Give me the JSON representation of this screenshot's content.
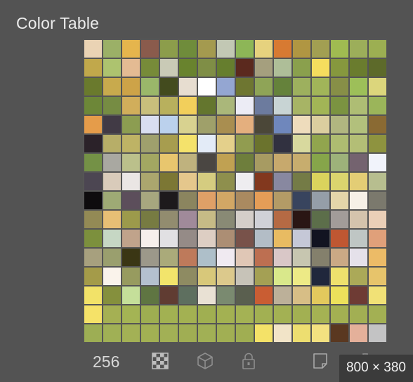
{
  "panel": {
    "title": "Color Table"
  },
  "color_table": {
    "rows": [
      [
        "#EAD3B4",
        "#9BB067",
        "#E5B54D",
        "#8A5B4C",
        "#8C9D4B",
        "#6F8C3B",
        "#A49A4F",
        "#C2C8B4",
        "#8DB657",
        "#E6D27E",
        "#D77A32",
        "#B09642",
        "#A29F52",
        "#A0BB51",
        "#9CAE5A",
        "#9CAF52"
      ],
      [
        "#C1A84B",
        "#ADC36F",
        "#E4BB93",
        "#778B39",
        "#C9CAB6",
        "#69832E",
        "#7F8E46",
        "#667E2E",
        "#5B291E",
        "#A59F7E",
        "#AEBE98",
        "#8AA04D",
        "#F5DD5E",
        "#86983E",
        "#6A7C2E",
        "#5D6A2A"
      ],
      [
        "#6A7A2D",
        "#C8AA4D",
        "#CDA348",
        "#9AB76A",
        "#434B1E",
        "#E7DDD0",
        "#FFFFFF",
        "#94A6D2",
        "#6E7631",
        "#8FA457",
        "#65823B",
        "#9DB05E",
        "#A1B559",
        "#878F47",
        "#9DBF59",
        "#DCD67C"
      ],
      [
        "#6D8738",
        "#768C43",
        "#D1AE5B",
        "#C8BF7C",
        "#B8B05D",
        "#F2CF5B",
        "#64762E",
        "#AAB77A",
        "#ECECF5",
        "#6C7B9E",
        "#C8D4D4",
        "#A7B465",
        "#A2B556",
        "#7B9341",
        "#AEBD74",
        "#9BB55A"
      ],
      [
        "#E59C4A",
        "#413A45",
        "#8C9D51",
        "#D9DEF1",
        "#BBD1ED",
        "#D8D290",
        "#9FA06A",
        "#A98E50",
        "#E4AF7E",
        "#4B4738",
        "#6F87BC",
        "#EEDCBC",
        "#DBCE9F",
        "#B1B680",
        "#B2C07C",
        "#8A6A33"
      ],
      [
        "#2B2229",
        "#B7AE68",
        "#BEB365",
        "#9FA06D",
        "#A79D4F",
        "#F4E26B",
        "#E3EBF7",
        "#E4D08B",
        "#919C50",
        "#6B732D",
        "#313140",
        "#D8D99E",
        "#91A54E",
        "#AEBC71",
        "#B3BE76",
        "#8E933F"
      ],
      [
        "#749146",
        "#A9A8A1",
        "#BBC08B",
        "#A3A762",
        "#E8C66E",
        "#BFB27E",
        "#4A4642",
        "#C0A152",
        "#6E7E3C",
        "#A79B62",
        "#C7A96D",
        "#C7AD6E",
        "#86A54A",
        "#9DB27A",
        "#74636F",
        "#F1F3FB"
      ],
      [
        "#4C4652",
        "#D9CBBA",
        "#EAE6E4",
        "#ABA66E",
        "#7C7734",
        "#E5C78C",
        "#D5CC80",
        "#8E8F4D",
        "#EEEDF0",
        "#82381E",
        "#8888A0",
        "#747B46",
        "#DAD35D",
        "#DBD46E",
        "#E3CD75",
        "#B7BE8F"
      ],
      [
        "#0E0C0E",
        "#9EAA75",
        "#5C4E5B",
        "#A7A77F",
        "#1D1A1C",
        "#8B855F",
        "#DFA067",
        "#D2A765",
        "#AA8A60",
        "#E59D57",
        "#B39B66",
        "#38445E",
        "#959EA8",
        "#E4D6A9",
        "#F6F0E7",
        "#7B796D"
      ],
      [
        "#938A55",
        "#E7BF75",
        "#9C9A4B",
        "#777B42",
        "#928C6F",
        "#A08A9A",
        "#C6BB86",
        "#898A75",
        "#D4CEC9",
        "#D0D1D7",
        "#B56A44",
        "#2A1614",
        "#5C6E4A",
        "#A29C99",
        "#D4C3AC",
        "#EBCFB7"
      ],
      [
        "#7C903D",
        "#C6D7C4",
        "#C0A38B",
        "#F6EFEC",
        "#E1E0E3",
        "#958B87",
        "#DDCEC3",
        "#AC8E74",
        "#78524A",
        "#B3BDC6",
        "#E8BB62",
        "#C5C8D7",
        "#121421",
        "#BF5732",
        "#BFC6C4",
        "#E0A07A"
      ],
      [
        "#A7A07E",
        "#9A9F6E",
        "#3A3614",
        "#9C988A",
        "#AAAA7A",
        "#BE7A5B",
        "#AEBFC9",
        "#F0EAF1",
        "#E0C7B6",
        "#BD6F51",
        "#D9C7C7",
        "#C7C6B0",
        "#84806C",
        "#CAA985",
        "#E5E1EA",
        "#ECBB67"
      ],
      [
        "#A49B49",
        "#FAF3EB",
        "#979B5F",
        "#B4C0CF",
        "#F2E46B",
        "#8E8B62",
        "#D8C87A",
        "#DCC98C",
        "#C7C3B8",
        "#A4A054",
        "#D9E88B",
        "#EDEA86",
        "#20273C",
        "#EEE16D",
        "#ABA958",
        "#E7C46B"
      ],
      [
        "#F2E268",
        "#85903D",
        "#C5DF9A",
        "#5F7542",
        "#603C32",
        "#5E6F5F",
        "#E9E1D4",
        "#7A8A70",
        "#5A5F4F",
        "#C95D33",
        "#BCB099",
        "#D7BE86",
        "#E3C95D",
        "#ECE15B",
        "#6E3B34",
        "#F1E176"
      ],
      [
        "#F5E268",
        "#A5B053",
        "#A4B454",
        "#9EAE51",
        "#A2B152",
        "#A3B152",
        "#A0AF51",
        "#A3B152",
        "#A4B254",
        "#A2B052",
        "#A3B153",
        "#A2B052",
        "#A5B253",
        "#A3B052",
        "#A2AF53",
        "#A3B053"
      ],
      [
        "#9DAE54",
        "#A0B055",
        "#A3B155",
        "#A2B053",
        "#A2B055",
        "#A0AE53",
        "#A1B055",
        "#A1AF53",
        "#A0AE52",
        "#F4E268",
        "#F2E4C8",
        "#EDDE70",
        "#F3E180",
        "#5A3820",
        "#E4B09A",
        "#C3C3C4"
      ]
    ],
    "count_label": "256"
  },
  "footer_icons": [
    "checkerboard-icon",
    "cube-icon",
    "lock-icon",
    "new-swatch-icon",
    "trash-icon"
  ],
  "overlay": {
    "size_label": "800 × 380"
  }
}
